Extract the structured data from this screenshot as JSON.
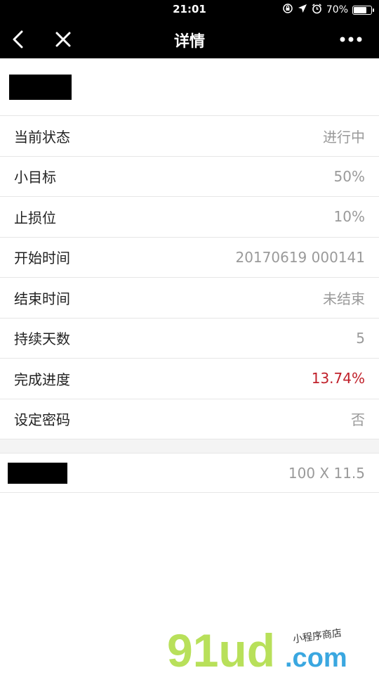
{
  "status_bar": {
    "time": "21:01",
    "battery": "70%",
    "icons": [
      "rotation-lock-icon",
      "location-arrow-icon",
      "alarm-icon",
      "battery-icon"
    ]
  },
  "nav": {
    "title": "详情",
    "back_icon": "chevron-left-icon",
    "close_icon": "close-icon",
    "more_icon": "more-dots-icon"
  },
  "details": [
    {
      "label": "当前状态",
      "value": "进行中"
    },
    {
      "label": "小目标",
      "value": "50%"
    },
    {
      "label": "止损位",
      "value": "10%"
    },
    {
      "label": "开始时间",
      "value": "20170619 000141"
    },
    {
      "label": "结束时间",
      "value": "未结束"
    },
    {
      "label": "持续天数",
      "value": "5"
    },
    {
      "label": "完成进度",
      "value": "13.74%"
    },
    {
      "label": "设定密码",
      "value": "否"
    }
  ],
  "footer": {
    "value": "100 X 11.5"
  },
  "watermark": {
    "brand": "91ud",
    "domain": ".com",
    "tagline": "小程序商店"
  },
  "colors": {
    "nav_bg": "#000000",
    "highlight": "#c0202a",
    "watermark_green": "#b8e05a",
    "watermark_blue": "#3aa7e0"
  }
}
